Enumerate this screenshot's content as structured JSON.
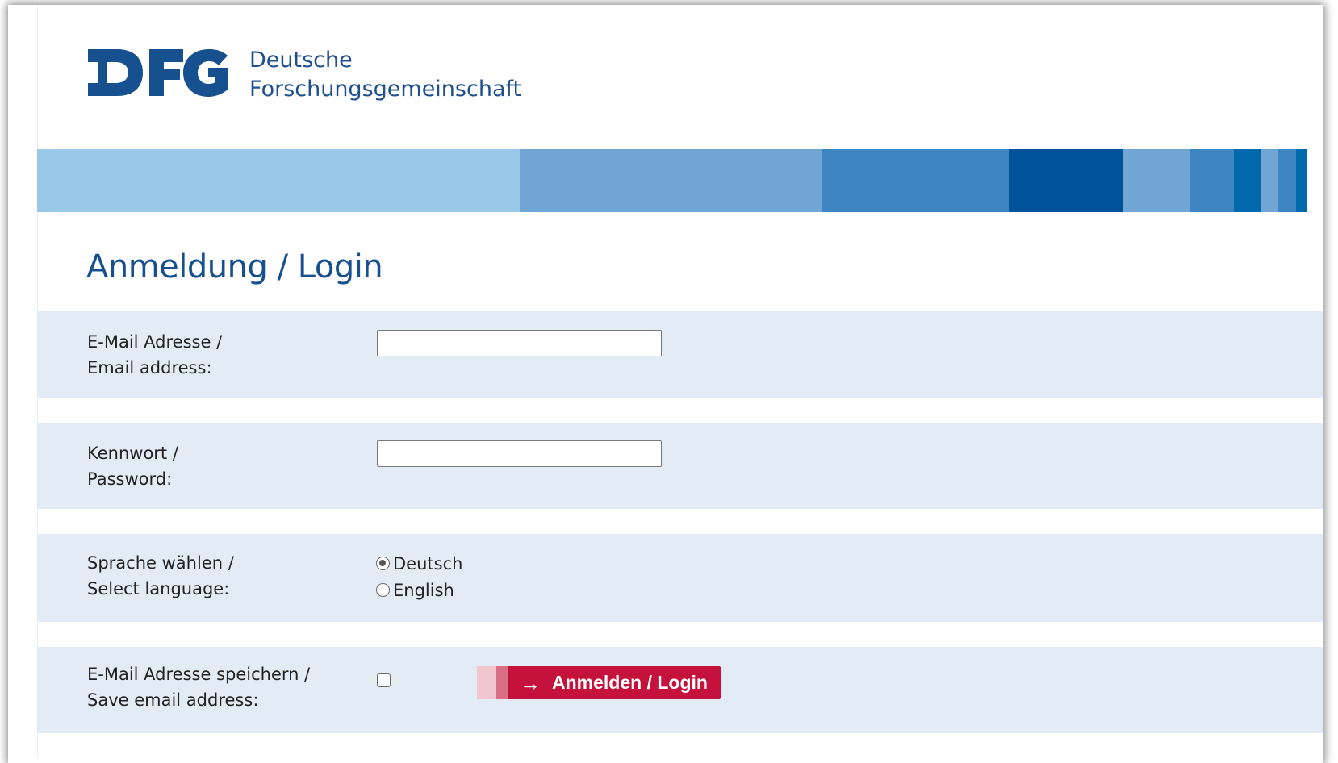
{
  "header": {
    "logo_mark": "DFG",
    "org_line1": "Deutsche",
    "org_line2": "Forschungsgemeinschaft"
  },
  "colors": {
    "brand_blue": "#17508f",
    "stripe": [
      "#9ac8e8",
      "#70a5d4",
      "#3f85c2",
      "#00529b",
      "#70a5d4",
      "#3f85c2",
      "#0069ad",
      "#70a5d4",
      "#3f85c2"
    ],
    "row_background": "#e3ebf5",
    "button_red": "#c4123d"
  },
  "page_title": "Anmeldung / Login",
  "form": {
    "email": {
      "label_line1": "E-Mail Adresse /",
      "label_line2": "Email address:",
      "value": "",
      "placeholder": ""
    },
    "password": {
      "label_line1": "Kennwort /",
      "label_line2": "Password:",
      "value": "",
      "placeholder": ""
    },
    "language": {
      "label_line1": "Sprache wählen /",
      "label_line2": "Select language:",
      "options": [
        {
          "label": "Deutsch",
          "selected": true
        },
        {
          "label": "English",
          "selected": false
        }
      ]
    },
    "save_email": {
      "label_line1": "E-Mail Adresse speichern /",
      "label_line2": "Save email address:",
      "checked": false
    },
    "login_button": {
      "icon": "arrow-right-icon",
      "label": "Anmelden / Login"
    }
  }
}
